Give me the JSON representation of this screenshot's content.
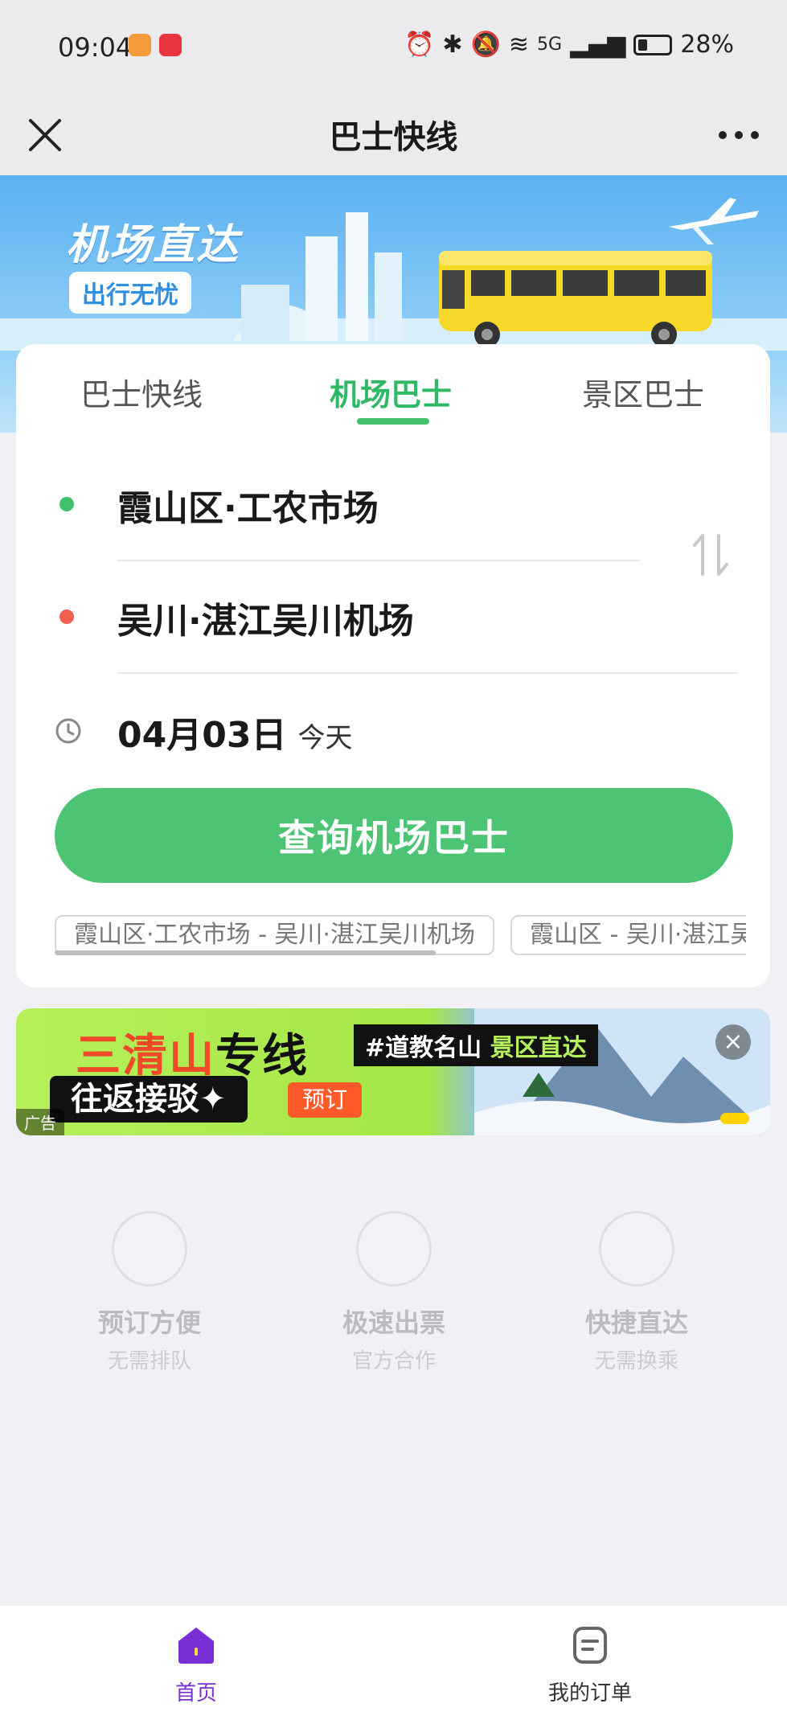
{
  "status_bar": {
    "time": "09:04",
    "battery": "28%",
    "network": "5G"
  },
  "nav": {
    "title": "巴士快线"
  },
  "banner": {
    "title": "机场直达",
    "subtitle": "出行无忧"
  },
  "tabs": [
    {
      "label": "巴士快线",
      "active": false
    },
    {
      "label": "机场巴士",
      "active": true
    },
    {
      "label": "景区巴士",
      "active": false
    }
  ],
  "route": {
    "from": "霞山区·工农市场",
    "to": "吴川·湛江吴川机场",
    "date": "04月03日",
    "date_sub": "今天"
  },
  "search_button": "查询机场巴士",
  "history": [
    "霞山区·工农市场 - 吴川·湛江吴川机场",
    "霞山区 - 吴川·湛江吴川机场"
  ],
  "ad": {
    "title_main": "三清山",
    "title_suffix": "专线",
    "tag_prefix": "#道教名山",
    "tag_highlight": "景区直达",
    "pill": "往返接驳✦",
    "book": "预订",
    "label": "广告"
  },
  "features": [
    {
      "title": "预订方便",
      "sub": "无需排队"
    },
    {
      "title": "极速出票",
      "sub": "官方合作"
    },
    {
      "title": "快捷直达",
      "sub": "无需换乘"
    }
  ],
  "tabbar": [
    {
      "label": "首页",
      "active": true
    },
    {
      "label": "我的订单",
      "active": false
    }
  ],
  "colors": {
    "primary_green": "#4dc474",
    "active_tab": "#2fb866",
    "from_dot": "#3fc26a",
    "to_dot": "#f06050",
    "tabbar_active": "#7a2fd6"
  }
}
